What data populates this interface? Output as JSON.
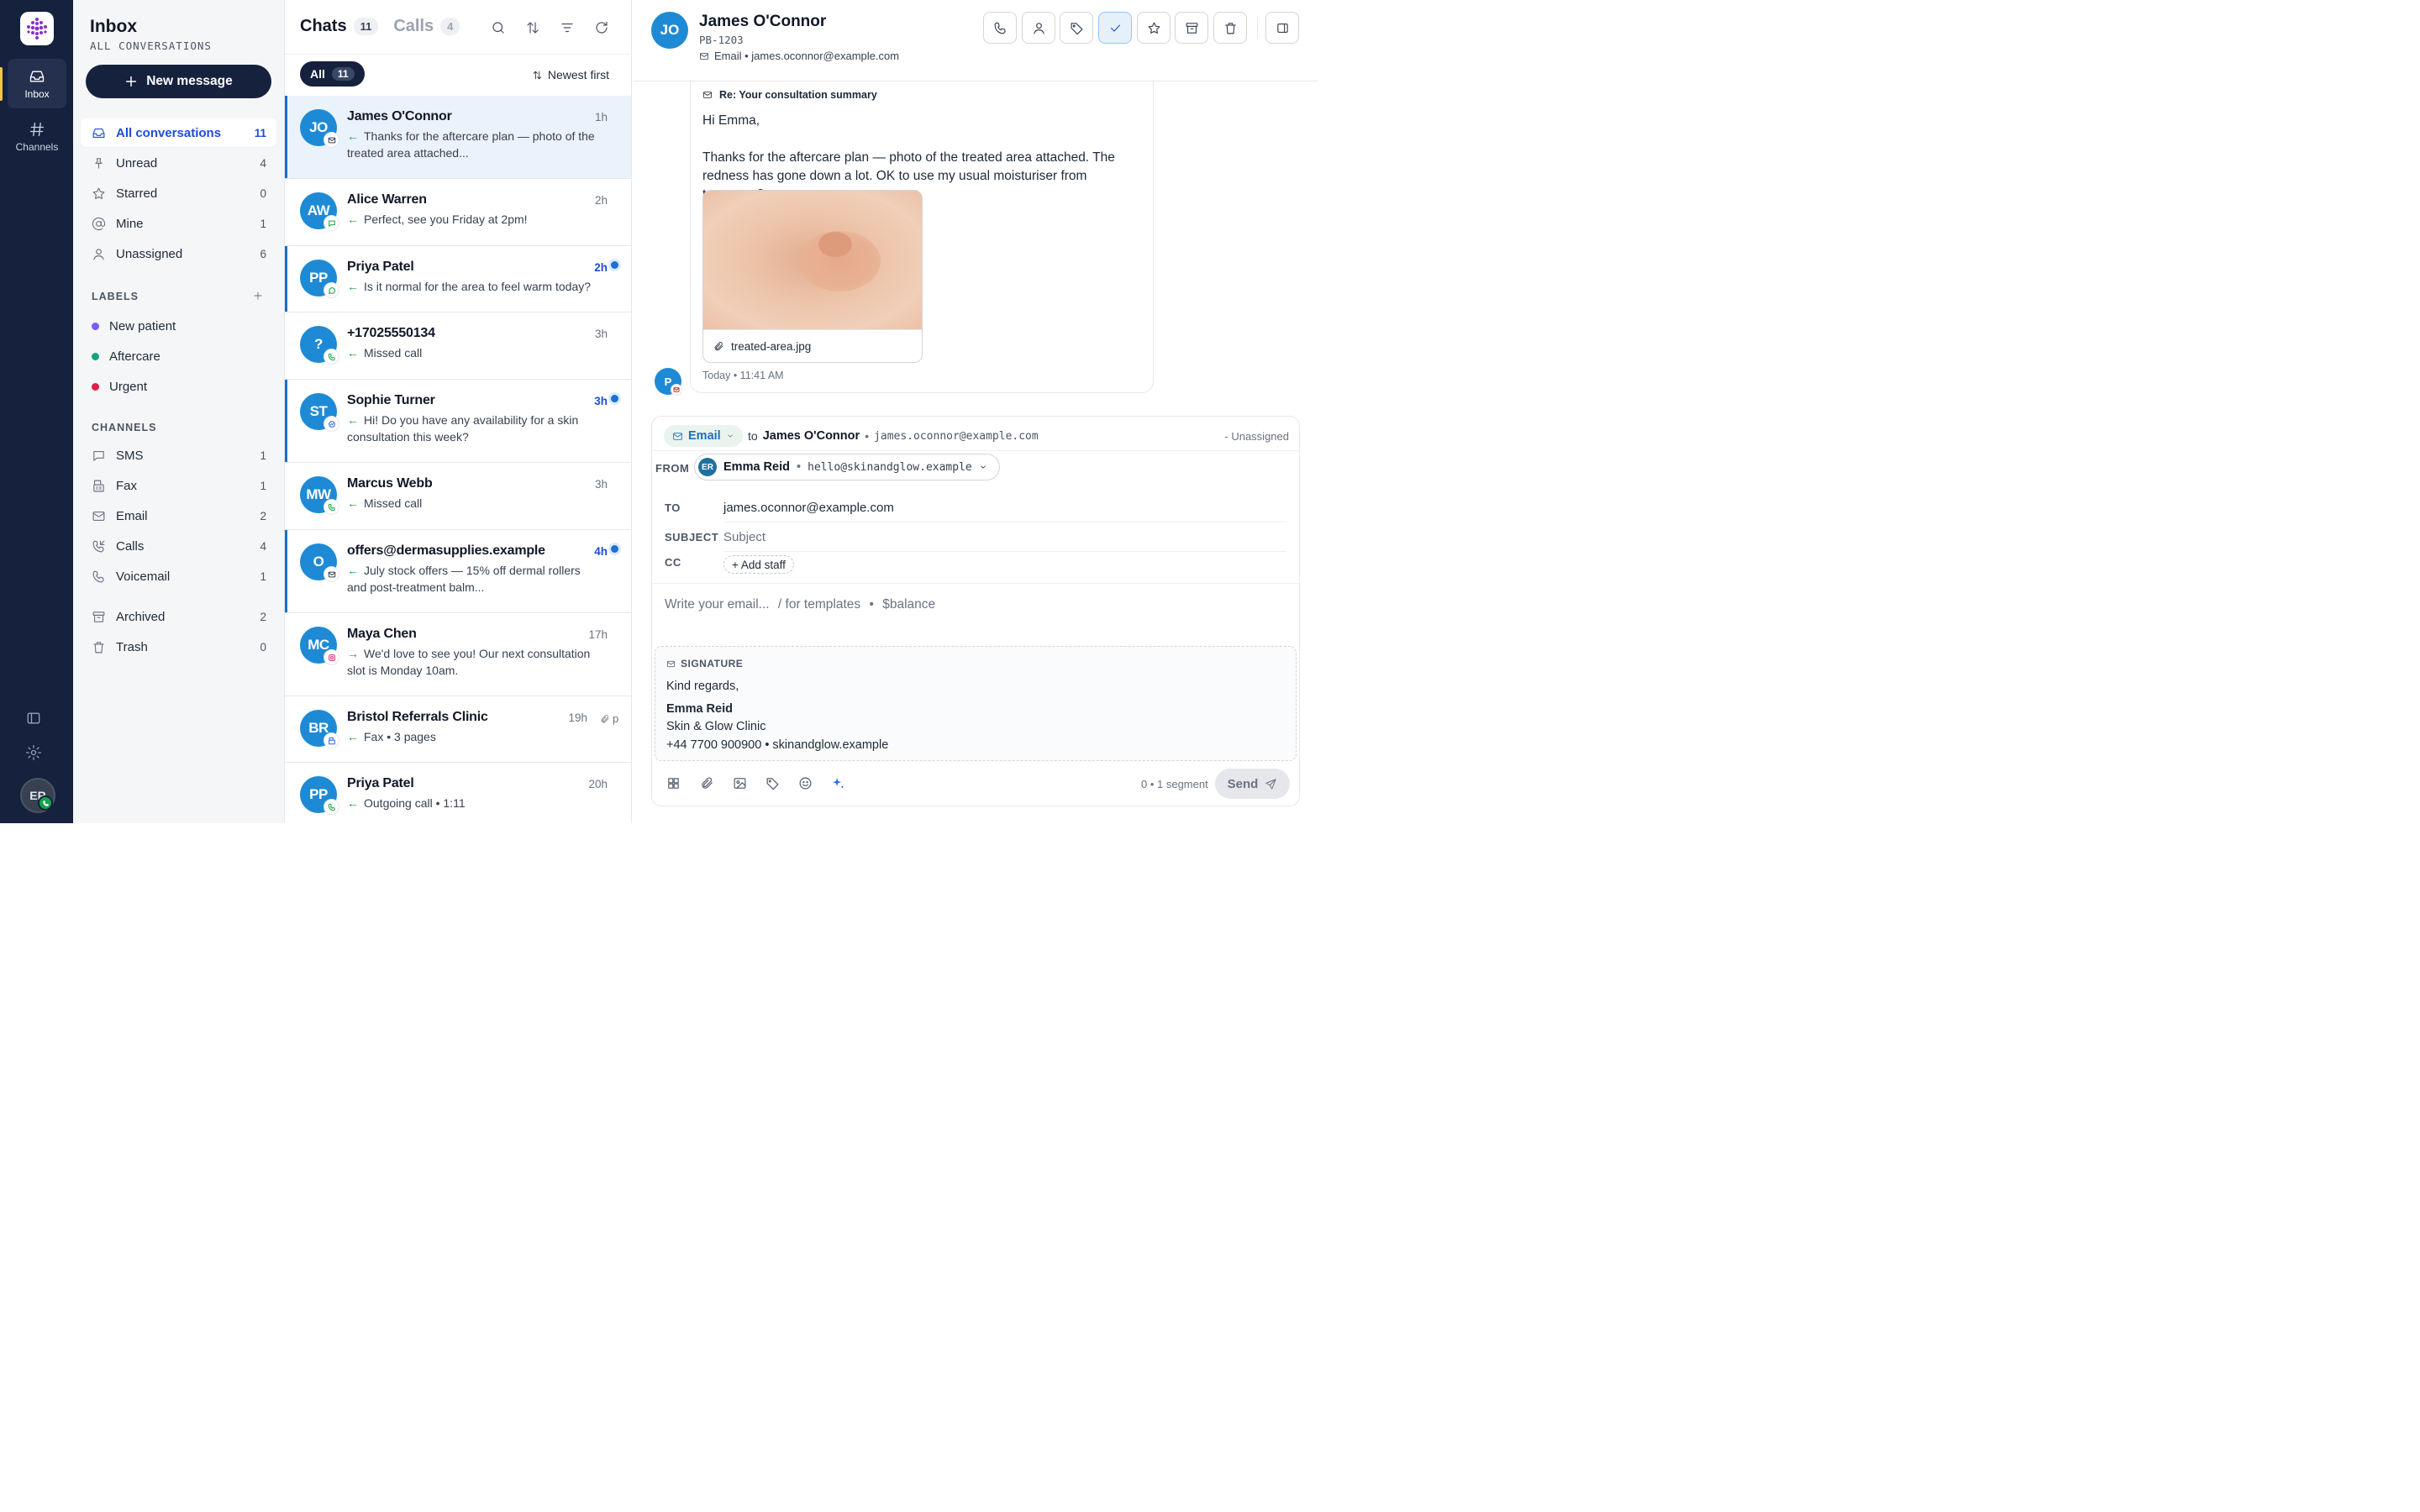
{
  "rail": {
    "items": [
      {
        "label": "Inbox"
      },
      {
        "label": "Channels"
      }
    ],
    "avatar": "ER"
  },
  "sidebar": {
    "title": "Inbox",
    "subtitle": "ALL CONVERSATIONS",
    "new_message": "New message",
    "nav": [
      {
        "label": "All conversations",
        "count": "11"
      },
      {
        "label": "Unread",
        "count": "4"
      },
      {
        "label": "Starred",
        "count": "0"
      },
      {
        "label": "Mine",
        "count": "1"
      },
      {
        "label": "Unassigned",
        "count": "6"
      }
    ],
    "labels_heading": "LABELS",
    "labels": [
      {
        "label": "New patient",
        "color": "#7c5cf2"
      },
      {
        "label": "Aftercare",
        "color": "#10a37f"
      },
      {
        "label": "Urgent",
        "color": "#e11d48"
      }
    ],
    "channels_heading": "CHANNELS",
    "channels": [
      {
        "label": "SMS",
        "count": "1"
      },
      {
        "label": "Fax",
        "count": "1"
      },
      {
        "label": "Email",
        "count": "2"
      },
      {
        "label": "Calls",
        "count": "4"
      },
      {
        "label": "Voicemail",
        "count": "1"
      }
    ],
    "archived": {
      "label": "Archived",
      "count": "2"
    },
    "trash": {
      "label": "Trash",
      "count": "0"
    }
  },
  "list": {
    "tab_chats": "Chats",
    "tab_chats_count": "11",
    "tab_calls": "Calls",
    "tab_calls_count": "4",
    "filter_all": "All",
    "filter_all_count": "11",
    "sort_label": "Newest first",
    "rows": [
      {
        "initials": "JO",
        "name": "James O'Connor",
        "time": "1h",
        "channel": "email",
        "preview": "Thanks for the aftercare plan — photo of the treated area attached...",
        "selected": true,
        "unread": false
      },
      {
        "initials": "AW",
        "name": "Alice Warren",
        "time": "2h",
        "channel": "sms",
        "preview": "Perfect, see you Friday at 2pm!",
        "selected": false,
        "unread": false
      },
      {
        "initials": "PP",
        "name": "Priya Patel",
        "time": "2h",
        "channel": "whatsapp",
        "preview": "Is it normal for the area to feel warm today?",
        "selected": false,
        "unread": true
      },
      {
        "initials": "?",
        "name": "+17025550134",
        "time": "3h",
        "channel": "call",
        "preview": "Missed call",
        "selected": false,
        "unread": false
      },
      {
        "initials": "ST",
        "name": "Sophie Turner",
        "time": "3h",
        "channel": "messenger",
        "preview": "Hi! Do you have any availability for a skin consultation this week?",
        "selected": false,
        "unread": true
      },
      {
        "initials": "MW",
        "name": "Marcus Webb",
        "time": "3h",
        "channel": "call",
        "preview": "Missed call",
        "selected": false,
        "unread": false
      },
      {
        "initials": "O",
        "name": "offers@dermasupplies.example",
        "time": "4h",
        "channel": "email",
        "preview": "July stock offers — 15% off dermal rollers and post-treatment balm...",
        "selected": false,
        "unread": true
      },
      {
        "initials": "MC",
        "name": "Maya Chen",
        "time": "17h",
        "channel": "instagram",
        "preview": "We'd love to see you! Our next consultation slot is Monday 10am.",
        "selected": false,
        "unread": false,
        "outgoing": true
      },
      {
        "initials": "BR",
        "name": "Bristol Referrals Clinic",
        "time": "19h",
        "channel": "fax",
        "preview": "Fax • 3 pages",
        "selected": false,
        "unread": false,
        "attach": "p"
      },
      {
        "initials": "PP",
        "name": "Priya Patel",
        "time": "20h",
        "channel": "call",
        "preview": "Outgoing call • 1:11",
        "selected": false,
        "unread": false
      }
    ]
  },
  "detail": {
    "initials": "JO",
    "name": "James O'Connor",
    "id": "PB-1203",
    "email_line": "Email • james.oconnor@example.com",
    "message": {
      "subject": "Re: Your consultation summary",
      "greeting": "Hi Emma,",
      "body": "Thanks for the aftercare plan — photo of the treated area attached. The redness has gone down a lot. OK to use my usual moisturiser from tomorrow?",
      "attachment": "treated-area.jpg",
      "time": "Today • 11:41 AM",
      "sender_initial": "P"
    },
    "composer": {
      "channel": "Email",
      "to_prefix": "to",
      "to_name": "James O'Connor",
      "to_email": "james.oconnor@example.com",
      "assignee": "- Unassigned",
      "from_label": "FROM",
      "from_initials": "ER",
      "from_name": "Emma Reid",
      "from_email": "hello@skinandglow.example",
      "to_label": "TO",
      "to_value": "james.oconnor@example.com",
      "subject_label": "SUBJECT",
      "subject_placeholder": "Subject",
      "cc_label": "CC",
      "add_staff": "+ Add staff",
      "write_placeholder": "Write your email...",
      "hint_templates": "/ for templates",
      "hint_balance": "$balance",
      "signature_label": "SIGNATURE",
      "sig_line1": "Kind regards,",
      "sig_name": "Emma Reid",
      "sig_clinic": "Skin & Glow Clinic",
      "sig_contact": "+44 7700 900900 • skinandglow.example",
      "segments": "0 • 1 segment",
      "send": "Send"
    }
  },
  "colors": {
    "rail": "#15213d",
    "accent": "#1e6fbf",
    "avatar": "#1e8ad6",
    "unread": "#1d6fd8"
  }
}
